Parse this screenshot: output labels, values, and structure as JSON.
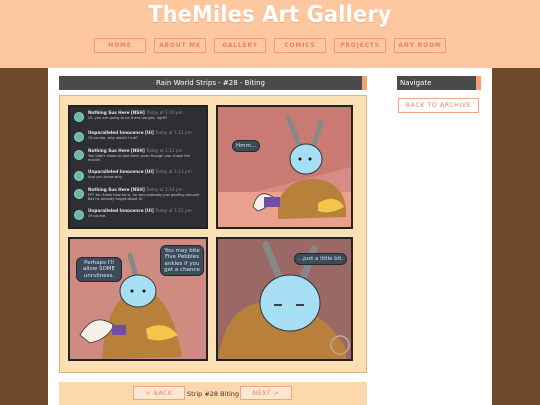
{
  "site": {
    "title": "TheMiles Art Gallery"
  },
  "nav": [
    "HOME",
    "ABOUT ME",
    "GALLERY",
    "COMICS",
    "PROJECTS",
    "ANY ROOM"
  ],
  "strip": {
    "title": "Rain World Strips - #28 - Biting",
    "label": "Strip #28 Biting",
    "prev": "< BACK",
    "next": "NEXT >"
  },
  "sidebar": {
    "title": "Navigate",
    "back_to_archive": "BACK TO ARCHIVE"
  },
  "chat": [
    {
      "name": "Nothing Sus Here [NSH]",
      "time": "Today at 1:10 pm",
      "text": "LK, you are going to be there tonight, right?"
    },
    {
      "name": "Unparalleled Innocence [UI]",
      "time": "Today at 1:11 pm",
      "text": "Of course, why would I not?"
    },
    {
      "name": "Nothing Sus Here [NSH]",
      "time": "Today at 1:12 pm",
      "text": "You didn't show up last time, even though you chose the movie!"
    },
    {
      "name": "Unparalleled Innocence [UI]",
      "time": "Today at 1:13 pm",
      "text": "And you know why."
    },
    {
      "name": "Nothing Sus Here [NSH]",
      "time": "Today at 1:14 pm",
      "text": "FP? You know how he is, he was probably just goofing around! Bet he already forgot about it!"
    },
    {
      "name": "Unparalleled Innocence [UI]",
      "time": "Today at 1:15 pm",
      "text": "Of course."
    }
  ],
  "speech": {
    "p2": "Hmm...",
    "p3_left": "Perhaps I'll allow SOME unruliness.",
    "p3_right": "You may bite Five Pebbles ankles if you get a chance",
    "p4": "...just a little bit."
  },
  "colors": {
    "header": "#fdc7a0",
    "accent": "#f2a073",
    "background": "#6e4a2c"
  }
}
